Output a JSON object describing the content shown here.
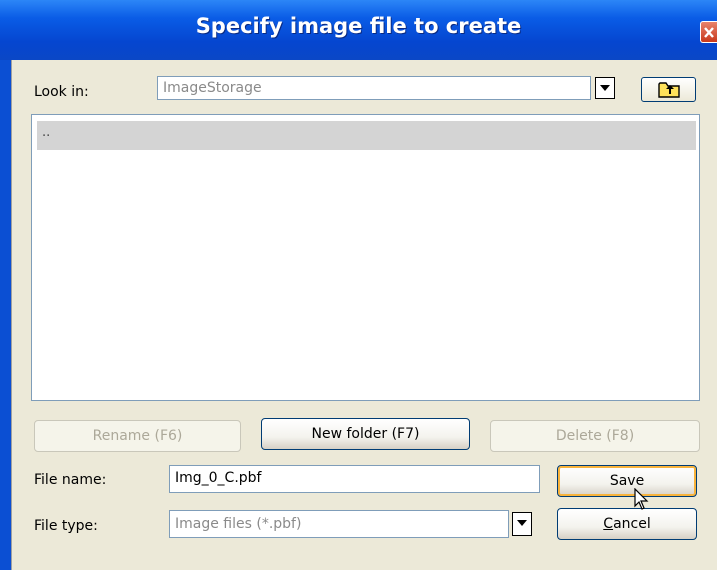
{
  "dialog": {
    "title": "Specify image file to create"
  },
  "look_in": {
    "label": "Look in:",
    "value": "ImageStorage"
  },
  "file_list": {
    "items": [
      ".."
    ]
  },
  "actions": {
    "rename": "Rename (F6)",
    "new_folder": "New folder (F7)",
    "delete": "Delete (F8)"
  },
  "file_name": {
    "label": "File name:",
    "value": "Img_0_C.pbf"
  },
  "file_type": {
    "label": "File type:",
    "value": "Image files (*.pbf)"
  },
  "buttons": {
    "save": "Save",
    "cancel_first": "C",
    "cancel_rest": "ancel"
  },
  "icons": {
    "close": "close-icon",
    "dropdown": "chevron-down-icon",
    "up_folder": "up-folder-icon",
    "cursor": "mouse-pointer-icon"
  },
  "colors": {
    "titlebar": "#0a5ce6",
    "client": "#ece9d8",
    "focus": "#f8b33c"
  }
}
